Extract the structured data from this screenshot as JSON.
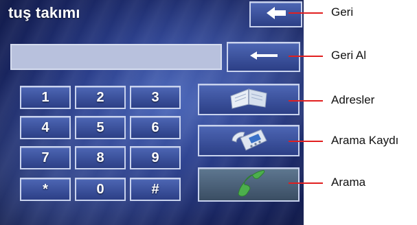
{
  "header": {
    "title": "tuş takımı"
  },
  "input": {
    "value": ""
  },
  "keypad": {
    "keys": [
      "1",
      "2",
      "3",
      "4",
      "5",
      "6",
      "7",
      "8",
      "9",
      "*",
      "0",
      "#"
    ]
  },
  "icons": {
    "back": "back-arrow-icon",
    "delete": "backspace-arrow-icon",
    "addresses": "address-book-icon",
    "call_log": "phone-keypad-icon",
    "call": "phone-handset-icon"
  },
  "callouts": {
    "back": "Geri",
    "delete": "Geri Al",
    "addresses": "Adresler",
    "call_log": "Arama Kaydı",
    "call": "Arama"
  },
  "colors": {
    "callout_line": "#e11f1f",
    "call_icon": "#4caf4c"
  }
}
